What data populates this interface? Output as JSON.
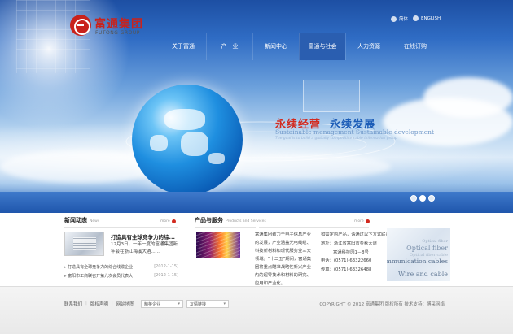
{
  "header": {
    "logo_cn": "富通集团",
    "logo_en": "FUTONG GROUP",
    "lang_cn": "简体",
    "lang_en": "ENGLISH"
  },
  "nav": {
    "items": [
      {
        "label": "关于富通",
        "active": false
      },
      {
        "label": "产　业",
        "active": false
      },
      {
        "label": "新闻中心",
        "active": false
      },
      {
        "label": "富通与社会",
        "active": true
      },
      {
        "label": "人力资源",
        "active": false
      },
      {
        "label": "在线订购",
        "active": false
      }
    ]
  },
  "banner": {
    "slogan_red": "永续经营",
    "slogan_blue": "永续发展",
    "slogan_en": "Sustainable management Sustainable development",
    "slogan_sub": "The goal is to build a globally competitive cable information group",
    "slide_count": 3,
    "active_slide": 2
  },
  "news": {
    "title": "新闻动态",
    "title_en": "News",
    "more": "more",
    "headline": "打造具有全球竞争力的综...",
    "summary": "12月3日，一年一度的富通集团新年会在浙江梅溪大酒......",
    "items": [
      {
        "title": "打造具有全球竞争力的综合线缆企业",
        "date": "[2012-1-15]"
      },
      {
        "title": "富阳市工商联召开第九次会员代表大",
        "date": "[2012-1-15]"
      }
    ]
  },
  "products": {
    "title": "产品与服务",
    "title_en": "Products and Services",
    "more": "more",
    "description": "富通集团致力于电子信息产业的发展，产业涵盖光电线缆、科技新材料和现代服务业三大领域。“十二五”期间，富通集团将重点瞄准战略性新兴产业内的超导技术和材料的研究、应用和产业化。",
    "contact": {
      "intro": "如需定购产品，请通过以下方式联系我们：",
      "address_line1": "地址：浙江省富阳市金秋大道",
      "address_line2": "富通科技园1－8号",
      "phone": "电话：(0571)-63322660",
      "fax": "传真：(0571)-63326488"
    },
    "cable_labels": [
      "Optical fiber",
      "Optical fiber cable",
      "Communication cables",
      "Wire and cable"
    ]
  },
  "footer": {
    "links": [
      "联系我们",
      "版权声明",
      "网站地图"
    ],
    "select_1": "精英企业",
    "select_2": "友情链接",
    "copyright": "COPYRIGHT © 2012 富通集团 版权所有 技术支持：博采网络"
  }
}
